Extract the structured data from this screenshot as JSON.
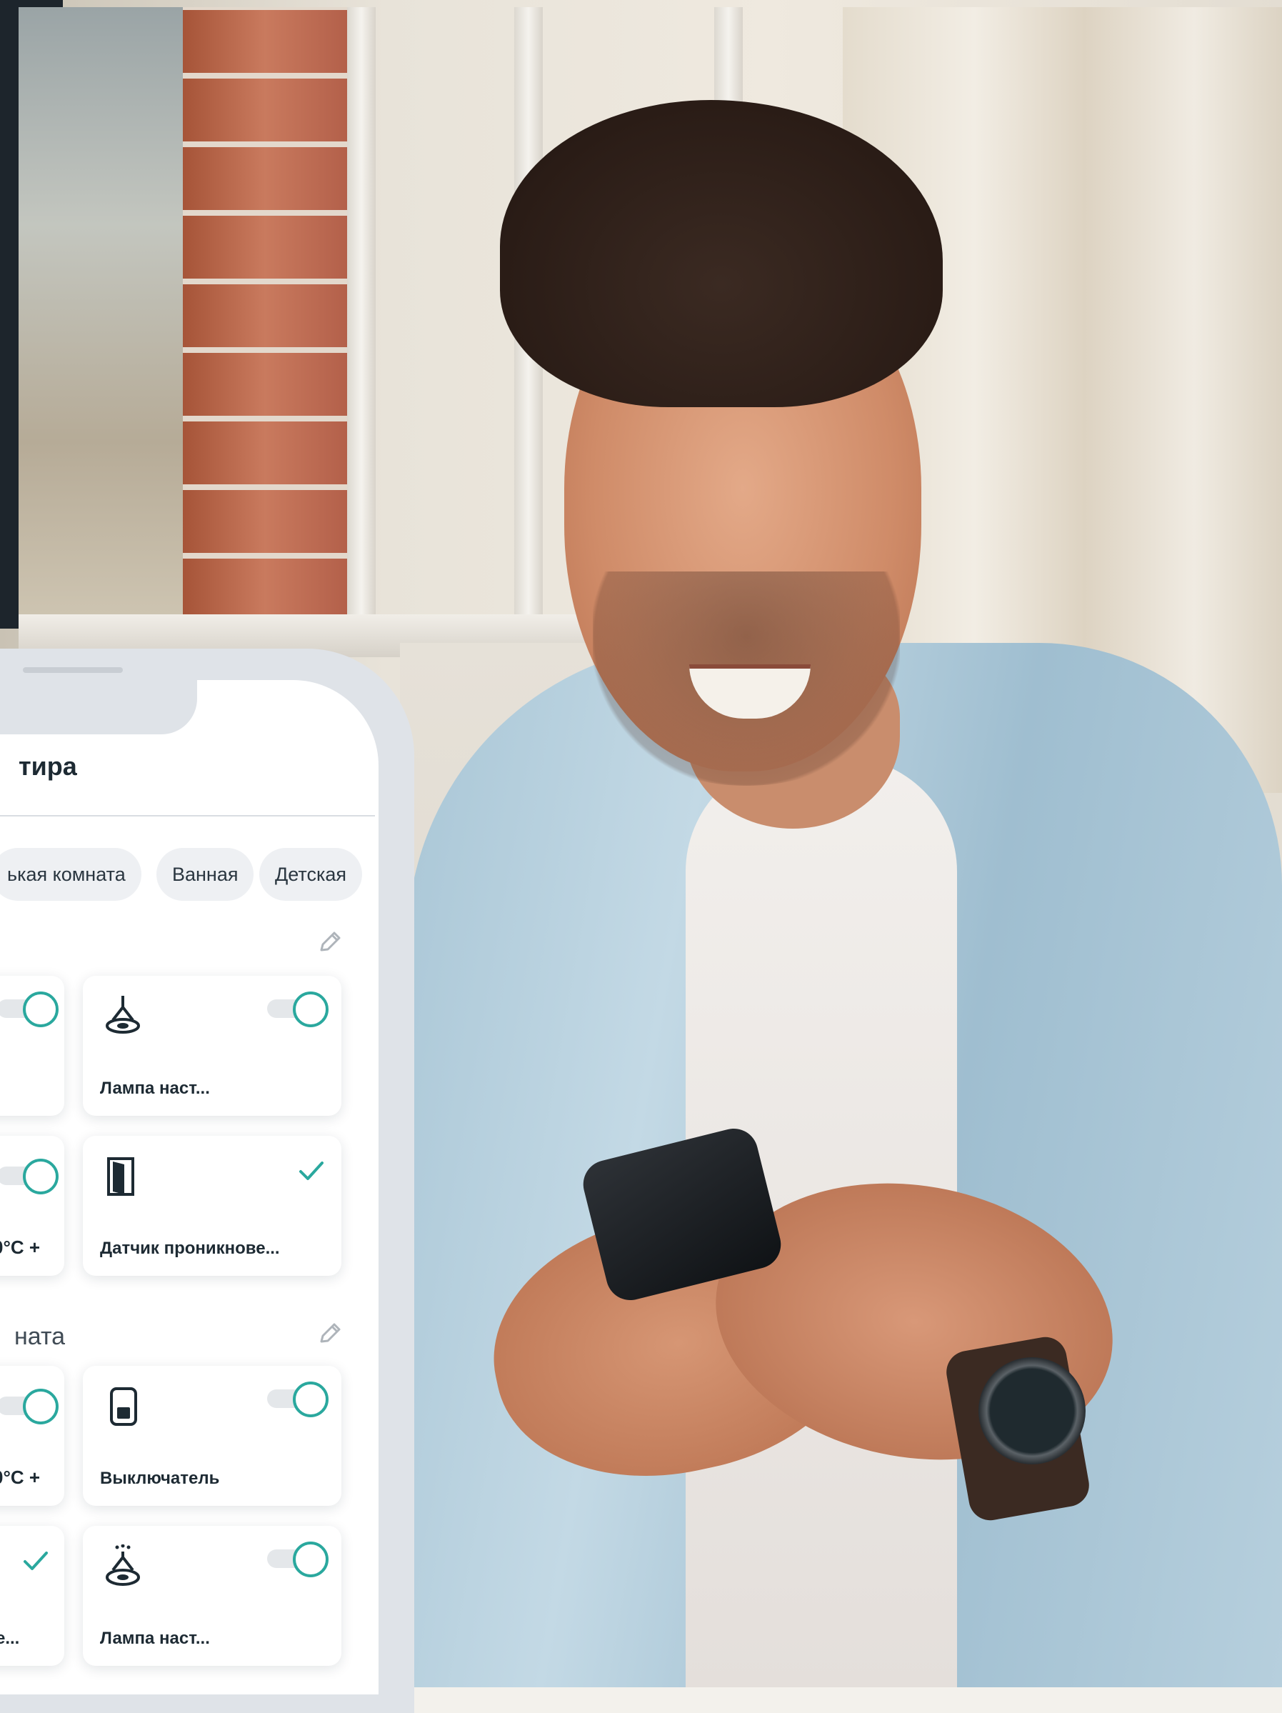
{
  "app": {
    "title_fragment": "тира"
  },
  "rooms": [
    {
      "label": "ькая комната"
    },
    {
      "label": "Ванная"
    },
    {
      "label": "Детская"
    }
  ],
  "sections": [
    {
      "label": "",
      "devices": [
        {
          "name": "",
          "icon": "partial-card",
          "control": "toggle-on"
        },
        {
          "name": "Лампа наст...",
          "icon": "ceiling-lamp-icon",
          "control": "toggle-on"
        },
        {
          "name": "0°C  +",
          "icon": "partial-card",
          "control": "toggle-on"
        },
        {
          "name": "Датчик проникнове...",
          "icon": "door-sensor-icon",
          "control": "check"
        }
      ]
    },
    {
      "label": "ната",
      "devices": [
        {
          "name": "0°C  +",
          "icon": "partial-card",
          "control": "toggle-on"
        },
        {
          "name": "Выключатель",
          "icon": "switch-icon",
          "control": "toggle-on"
        },
        {
          "name": "е...",
          "icon": "partial-card",
          "control": "check"
        },
        {
          "name": "Лампа наст...",
          "icon": "lamp-light-icon",
          "control": "toggle-on"
        }
      ]
    }
  ],
  "colors": {
    "accent": "#2aa89e",
    "card_text": "#1d2a33",
    "chip_bg": "#eef0f3",
    "phone_frame": "#dfe3e8"
  }
}
